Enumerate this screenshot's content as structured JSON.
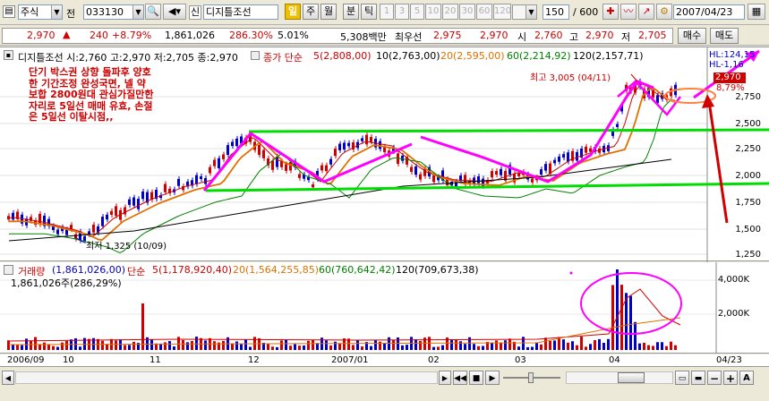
{
  "toolbar": {
    "market_type": "주식",
    "mode": "전",
    "code": "033130",
    "new_badge": "신",
    "stock_name": "디지틀조선",
    "period_day": "일",
    "period_week": "주",
    "period_month": "월",
    "period_minute": "분",
    "period_tick": "틱",
    "minute_steps": [
      "1",
      "3",
      "5",
      "10",
      "20",
      "30",
      "60",
      "120"
    ],
    "count": "150",
    "count_total": "/ 600",
    "date": "2007/04/23"
  },
  "quote": {
    "price": "2,970",
    "change": "240",
    "change_pct": "+8.79%",
    "volume": "1,861,026",
    "volume_ratio": "286.30%",
    "turnover": "5.01%",
    "amount": "5,308백만",
    "best_label": "최우선",
    "best_ask": "2,975",
    "best_bid": "2,970",
    "open_label": "시",
    "open": "2,760",
    "high_label": "고",
    "high": "2,970",
    "low_label": "저",
    "low": "2,705",
    "buy_button": "매수",
    "sell_button": "매도"
  },
  "price_panel": {
    "ohlc_text": "디지틀조선 시:2,760 고:2,970 저:2,705 종:2,970",
    "ma_header": "종가 단순",
    "ma5": "5(2,808,00)",
    "ma10": "10(2,763,00)",
    "ma20": "20(2,595,00)",
    "ma60": "60(2,214,92)",
    "ma120": "120(2,157,71)",
    "hl_hi": "HL:124,15",
    "hl_lo": "HL-1,16",
    "high_marker": "최고 3,005 (04/11)",
    "low_marker": "최저 1,325 (10/09)",
    "current_badge": "2,970",
    "current_pct": "8,79%",
    "axis": [
      "2,750",
      "2,500",
      "2,250",
      "2,000",
      "1,750",
      "1,500",
      "1,250"
    ]
  },
  "annotation": {
    "lines": [
      "단기 박스권 상향 돌파후 양호",
      "한 기간조정 완성국면, 넬 약",
      "보합 2800원대 관심가질만한",
      "자리로 5일선 매매 유효, 손절",
      "은 5일선 이탈시점,,"
    ]
  },
  "volume_panel": {
    "label": "거래량",
    "value": "(1,861,026,00)",
    "ma_header": "단순",
    "ma5": "5(1,178,920,40)",
    "ma20": "20(1,564,255,85)",
    "ma60": "60(760,642,42)",
    "ma120": "120(709,673,38)",
    "summary": "1,861,026주(286,29%)",
    "axis": [
      "4,000K",
      "2,000K"
    ]
  },
  "date_axis": {
    "labels": [
      "2006/09",
      "10",
      "11",
      "12",
      "2007/01",
      "02",
      "03",
      "04"
    ],
    "current": "04/23"
  },
  "colors": {
    "up": "#d00000",
    "down": "#0000c8",
    "ma5": "#d00000",
    "ma10": "#000000",
    "ma20": "#e07000",
    "ma60": "#008000",
    "ma120": "#000000",
    "annotation_magenta": "#ff00ff",
    "annotation_green": "#00dd00"
  }
}
